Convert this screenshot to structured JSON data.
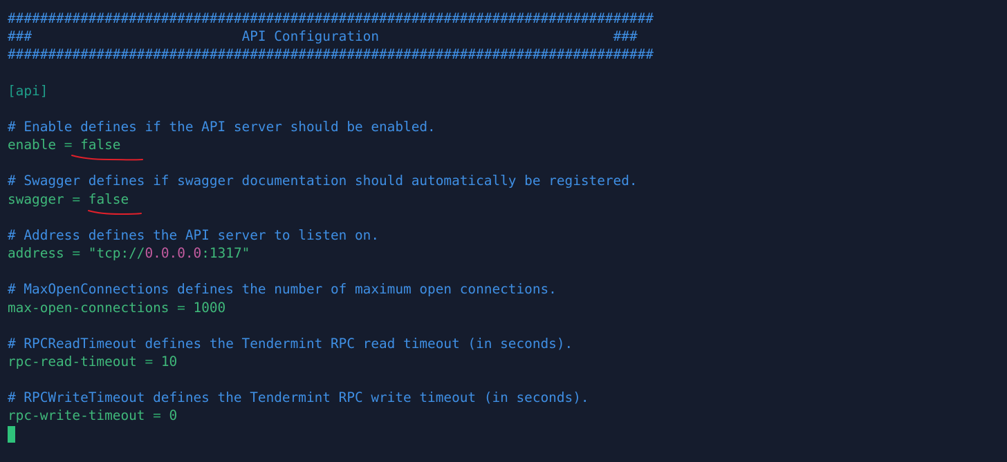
{
  "header": {
    "border_top": "################################################################################",
    "title_prefix": "###",
    "title_pad_left": "                          ",
    "title": "API Configuration",
    "title_pad_right": "                             ",
    "title_suffix": "###",
    "border_bottom": "################################################################################"
  },
  "section": "[api]",
  "settings": [
    {
      "comment": "# Enable defines if the API server should be enabled.",
      "key": "enable",
      "op": " = ",
      "value": "false"
    },
    {
      "comment": "# Swagger defines if swagger documentation should automatically be registered.",
      "key": "swagger",
      "op": " = ",
      "value": "false"
    },
    {
      "comment": "# Address defines the API server to listen on.",
      "key": "address",
      "op": " = ",
      "value_prefix": "\"tcp://",
      "value_ip": "0.0.0.0",
      "value_sep": ":",
      "value_port": "1317",
      "value_suffix": "\""
    },
    {
      "comment": "# MaxOpenConnections defines the number of maximum open connections.",
      "key": "max-open-connections",
      "op": " = ",
      "value": "1000"
    },
    {
      "comment": "# RPCReadTimeout defines the Tendermint RPC read timeout (in seconds).",
      "key": "rpc-read-timeout",
      "op": " = ",
      "value": "10"
    },
    {
      "comment": "# RPCWriteTimeout defines the Tendermint RPC write timeout (in seconds).",
      "key": "rpc-write-timeout",
      "op": " = ",
      "value": "0"
    }
  ],
  "colors": {
    "background": "#151c2d",
    "comment": "#3f8fe4",
    "key": "#3fb87a",
    "section": "#1f9f8a",
    "number_highlight": "#c25b9f",
    "cursor": "#2fc27b",
    "annotation": "#e0202a"
  }
}
